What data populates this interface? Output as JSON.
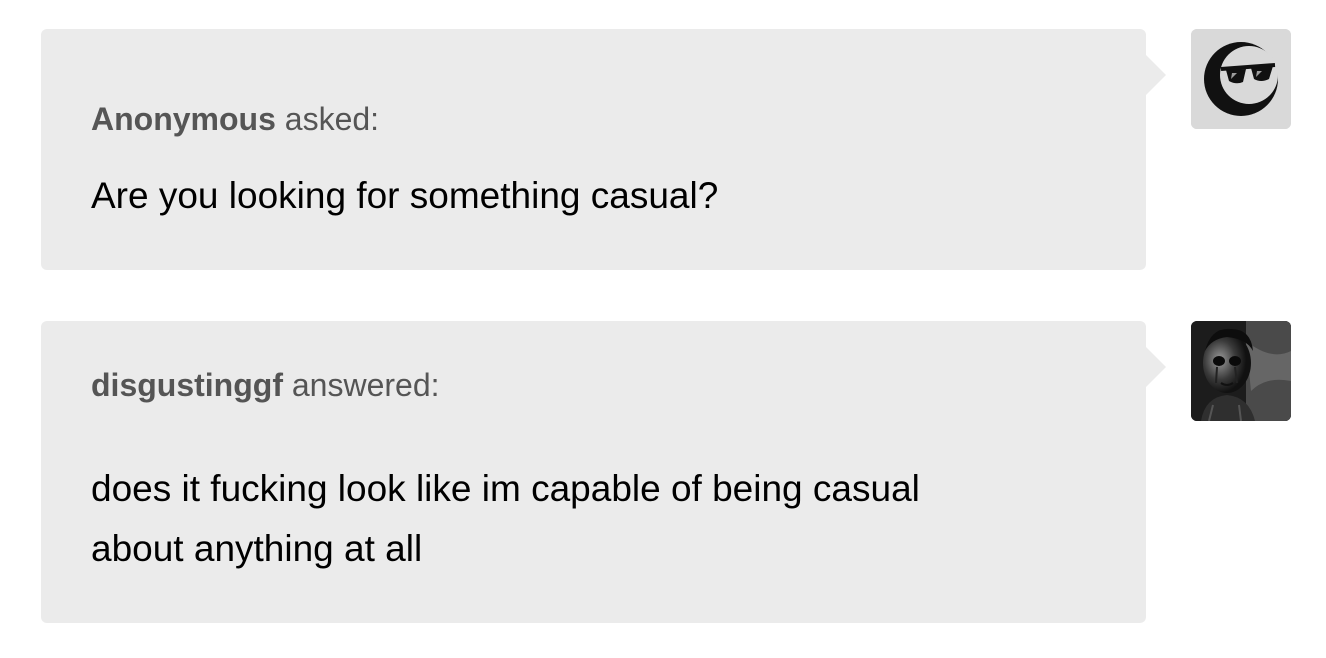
{
  "ask": {
    "asker": "Anonymous",
    "verb": "asked:",
    "question": "Are you looking for something casual?"
  },
  "answer": {
    "answerer": "disgustinggf",
    "verb": "answered:",
    "lines": [
      "does it fucking look like im capable of being casual",
      "about anything at all"
    ]
  },
  "avatars": {
    "anon": "anonymous-sunglasses-icon",
    "user": "user-photo-avatar"
  },
  "colors": {
    "bubble": "#ebebeb",
    "meta_text": "#555555",
    "body_text": "#000000"
  }
}
